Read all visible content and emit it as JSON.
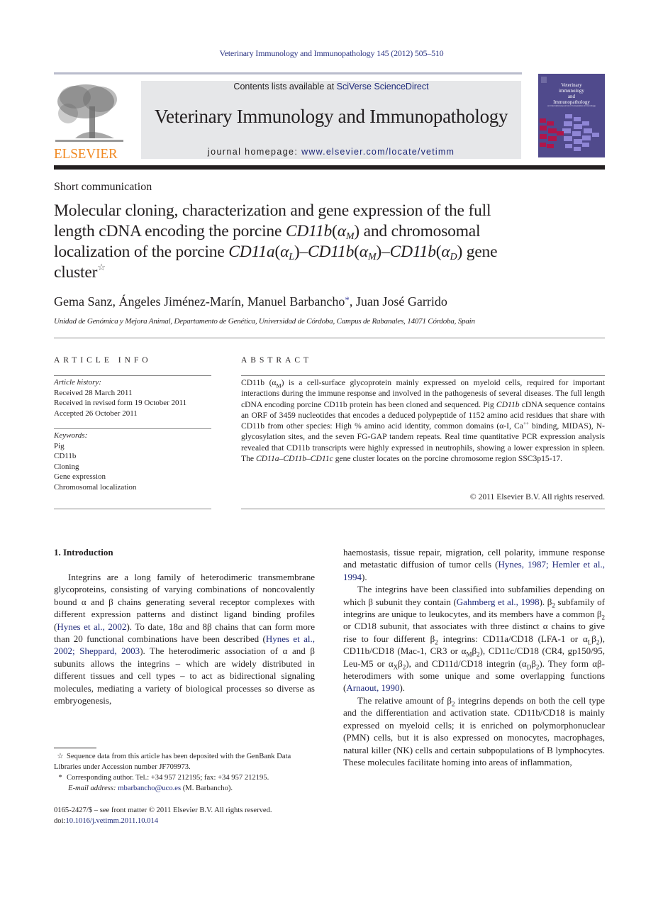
{
  "header": {
    "running_head": "Veterinary Immunology and Immunopathology 145 (2012) 505–510",
    "contents_prefix": "Contents lists available at ",
    "contents_link": "SciVerse ScienceDirect",
    "journal_title": "Veterinary Immunology and Immunopathology",
    "homepage_prefix": "journal homepage: ",
    "homepage_link": "www.elsevier.com/locate/vetimm",
    "publisher_logo_text": "ELSEVIER",
    "cover": {
      "title_line1": "Veterinary",
      "title_line2": "immunology",
      "title_line3": "and",
      "title_line4": "Immunopathology",
      "subtitle": "an international journal of comparative immunology",
      "colors": {
        "background": "#504a8c",
        "accent_red": "#b0154a",
        "accent_lilac": "#8f86d6"
      }
    }
  },
  "article": {
    "type": "Short communication",
    "title_parts": {
      "t1": "Molecular cloning, characterization and gene expression of the full",
      "t2": "length cDNA encoding the porcine ",
      "t3_gene": "CD11b",
      "t3_alpha": "α",
      "t3_sub": "M",
      "t4": " and chromosomal",
      "t5": "localization of the porcine ",
      "g1": "CD11a",
      "g1_sub": "L",
      "g2": "CD11b",
      "g2_sub": "M",
      "g3": "CD11b",
      "g3_sub": "D",
      "t6": " gene",
      "t7": "cluster",
      "star": "☆"
    },
    "authors": {
      "a1": "Gema Sanz, Ángeles Jiménez-Marín, Manuel Barbancho",
      "a1_mark": "*",
      "a2": ", Juan José Garrido"
    },
    "affiliation": "Unidad de Genómica y Mejora Animal, Departamento de Genética, Universidad de Córdoba, Campus de Rabanales, 14071 Córdoba, Spain"
  },
  "article_info": {
    "label": "ARTICLE INFO",
    "history_head": "Article history:",
    "history": [
      "Received 28 March 2011",
      "Received in revised form 19 October 2011",
      "Accepted 26 October 2011"
    ],
    "keywords_head": "Keywords:",
    "keywords": [
      "Pig",
      "CD11b",
      "Cloning",
      "Gene expression",
      "Chromosomal localization"
    ]
  },
  "abstract": {
    "label": "ABSTRACT",
    "p1": "CD11b (α",
    "p1_sub": "M",
    "p2": ") is a cell-surface glycoprotein mainly expressed on myeloid cells, required for important interactions during the immune response and involved in the pathogenesis of several diseases. The full length cDNA encoding porcine CD11b protein has been cloned and sequenced. Pig ",
    "p2_italic": "CD11b",
    "p3": " cDNA sequence contains an ORF of 3459 nucleotides that encodes a deduced polypeptide of 1152 amino acid residues that share with CD11b from other species: High % amino acid identity, common domains (α-I, Ca",
    "p3_sup": "++",
    "p4": " binding, MIDAS), N-glycosylation sites, and the seven FG-GAP tandem repeats. Real time quantitative PCR expression analysis revealed that CD11b transcripts were highly expressed in neutrophils, showing a lower expression in spleen. The ",
    "p4_italic": "CD11a–CD11b–CD11c",
    "p5": " gene cluster locates on the porcine chromosome region SSC3p15-17.",
    "copyright": "© 2011 Elsevier B.V. All rights reserved."
  },
  "introduction": {
    "heading": "1.  Introduction",
    "left": {
      "s1": "Integrins are a long family of heterodimeric transmembrane glycoproteins, consisting of varying combinations of noncovalently bound α and β chains generating several receptor complexes with different expression patterns and distinct ligand binding profiles (",
      "c1": "Hynes et al., 2002",
      "s2": "). To date, 18α and 8β chains that can form more than 20 functional combinations have been described (",
      "c2": "Hynes et al., 2002; Sheppard, 2003",
      "s3": "). The heterodimeric association of α and β subunits allows the integrins – which are widely distributed in different tissues and cell types – to act as bidirectional signaling molecules, mediating a variety of biological processes so diverse as embryogenesis,"
    },
    "right": {
      "s1": "haemostasis, tissue repair, migration, cell polarity, immune response and metastatic diffusion of tumor cells (",
      "c1": "Hynes, 1987; Hemler et al., 1994",
      "s2": ").",
      "p2a": "The integrins have been classified into subfamilies depending on which β subunit they contain (",
      "c2": "Gahmberg et al., 1998",
      "p2b": "). β",
      "p2c": " subfamily of integrins are unique to leukocytes, and its members have a common β",
      "p2d": " or CD18 subunit, that associates with three distinct α chains to give rise to four different β",
      "p2e": " integrins: CD11a/CD18 (LFA-1 or α",
      "p2f": "β",
      "p2g": "), CD11b/CD18 (Mac-1, CR3 or α",
      "p2h": "), CD11c/CD18 (CR4, gp150/95, Leu-M5 or α",
      "p2i": "), and CD11d/CD18 integrin (α",
      "p2j": "). They form αβ-heterodimers with some unique and some overlapping functions (",
      "c3": "Arnaout, 1990",
      "p2k": ").",
      "sub2": "2",
      "subL": "L",
      "subM": "M",
      "subX": "X",
      "subD": "D",
      "p3a": "The relative amount of β",
      "p3b": " integrins depends on both the cell type and the differentiation and activation state. CD11b/CD18 is mainly expressed on myeloid cells; it is enriched on polymorphonuclear (PMN) cells, but it is also expressed on monocytes, macrophages, natural killer (NK) cells and certain subpopulations of B lymphocytes. These molecules facilitate homing into areas of inflammation,"
    }
  },
  "footnotes": {
    "f1_mark": "☆",
    "f1": "Sequence data from this article has been deposited with the GenBank Data Libraries under Accession number JF709973.",
    "f2_mark": "*",
    "f2": "Corresponding author. Tel.: +34 957 212195; fax: +34 957 212195.",
    "email_label": "E-mail address: ",
    "email": "mbarbancho@uco.es",
    "email_suffix": " (M. Barbancho).",
    "issn": "0165-2427/$ – see front matter © 2011 Elsevier B.V. All rights reserved.",
    "doi_prefix": "doi:",
    "doi": "10.1016/j.vetimm.2011.10.014"
  }
}
